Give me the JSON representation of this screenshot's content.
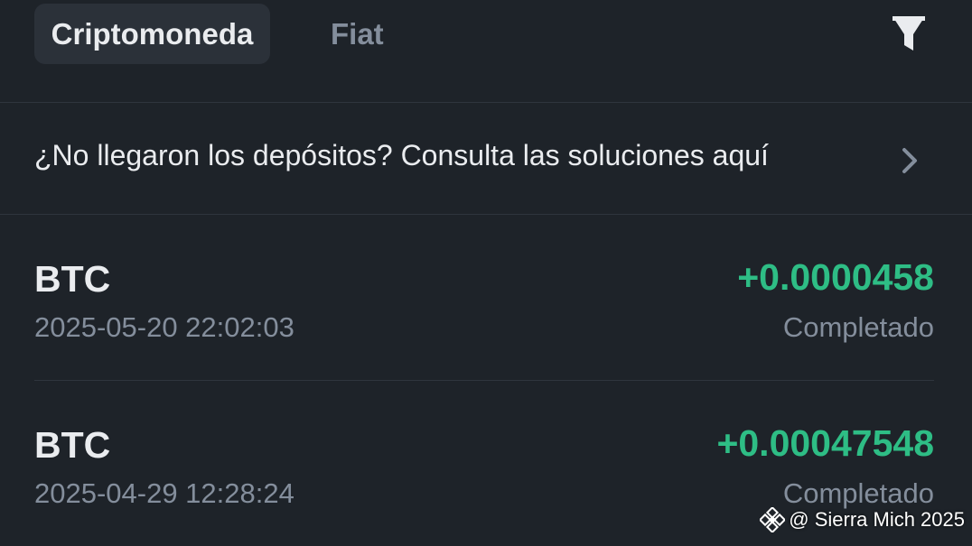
{
  "tabs": [
    {
      "label": "Criptomoneda",
      "active": true
    },
    {
      "label": "Fiat",
      "active": false
    }
  ],
  "filter_icon": "funnel-filter-icon",
  "banner": {
    "text": "¿No llegaron los depósitos? Consulta las soluciones aquí",
    "icon": "chevron-right-icon"
  },
  "transactions": [
    {
      "coin": "BTC",
      "datetime": "2025-05-20 22:02:03",
      "amount": "+0.0000458",
      "status": "Completado"
    },
    {
      "coin": "BTC",
      "datetime": "2025-04-29 12:28:24",
      "amount": "+0.00047548",
      "status": "Completado"
    }
  ],
  "watermark": {
    "text": "@ Sierra Mich 2025",
    "icon": "binance-logo-icon"
  },
  "colors": {
    "background": "#1e2329",
    "active_tab_bg": "#2b3139",
    "positive_amount": "#2ebd85",
    "muted_text": "#848e9c",
    "primary_text": "#eaecef"
  }
}
